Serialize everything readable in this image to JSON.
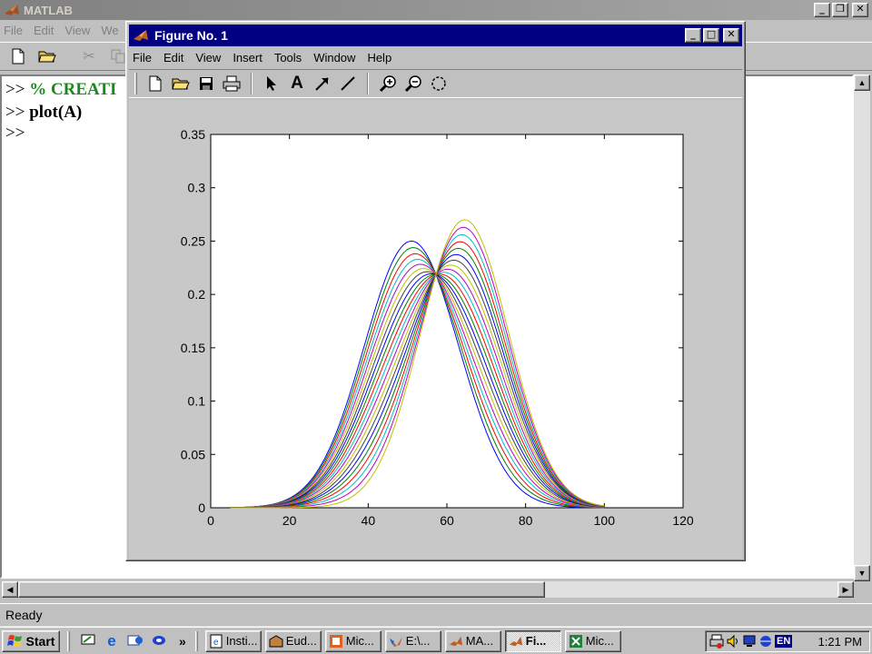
{
  "matlab": {
    "title": "MATLAB",
    "menu": [
      "File",
      "Edit",
      "View",
      "We"
    ],
    "command_lines": [
      {
        "prompt": ">>",
        "text": "% CREATI",
        "color": "#1a8a1a"
      },
      {
        "prompt": ">>",
        "text": "plot(A)",
        "color": "#000000"
      },
      {
        "prompt": ">>",
        "text": "",
        "color": "#000000"
      }
    ],
    "status": "Ready"
  },
  "figure": {
    "title": "Figure No. 1",
    "menu": [
      "File",
      "Edit",
      "View",
      "Insert",
      "Tools",
      "Window",
      "Help"
    ],
    "toolbar_icons": [
      "new-file-icon",
      "open-folder-icon",
      "save-icon",
      "print-icon",
      "arrow-select-icon",
      "text-insert-icon",
      "arrow-insert-icon",
      "line-insert-icon",
      "zoom-in-icon",
      "zoom-out-icon",
      "rotate-3d-icon"
    ]
  },
  "chart_data": {
    "type": "line",
    "title": "",
    "xlabel": "",
    "ylabel": "",
    "xlim": [
      0,
      120
    ],
    "ylim": [
      0,
      0.35
    ],
    "xticks": [
      0,
      20,
      40,
      60,
      80,
      100,
      120
    ],
    "yticks": [
      0,
      0.05,
      0.1,
      0.15,
      0.2,
      0.25,
      0.3,
      0.35
    ],
    "ytick_labels": [
      "0",
      "0.05",
      "0.1",
      "0.15",
      "0.2",
      "0.25",
      "0.3",
      "0.35"
    ],
    "grid": false,
    "legend": "none",
    "x_range": [
      5,
      100
    ],
    "crossing_point": {
      "x": 57,
      "y": 0.225
    },
    "series_count": 20,
    "curve_description": "Family of mixture curves of two Gaussian components (peak 51, sd 12 and peak 65, sd 11), weight shifting gradually from the first to the second",
    "components": [
      {
        "mean": 51,
        "sd": 12,
        "peak": 0.25
      },
      {
        "mean": 64.5,
        "sd": 11.2,
        "peak": 0.27
      }
    ],
    "colors": [
      "#0000ff",
      "#008000",
      "#ff0000",
      "#00bfbf",
      "#bf00bf",
      "#bfbf00",
      "#404040"
    ]
  },
  "taskbar": {
    "start_label": "Start",
    "quick_launch": [
      "desktop-icon",
      "internet-explorer-icon",
      "outlook-icon",
      "channels-icon"
    ],
    "more": "»",
    "tasks": [
      {
        "label": "Insti...",
        "icon": "ie-page-icon",
        "active": false
      },
      {
        "label": "Eud...",
        "icon": "eudora-icon",
        "active": false
      },
      {
        "label": "Mic...",
        "icon": "powerpoint-icon",
        "active": false
      },
      {
        "label": "E:\\...",
        "icon": "folder-icon",
        "active": false
      },
      {
        "label": "MA...",
        "icon": "matlab-icon",
        "active": false
      },
      {
        "label": "Fi...",
        "icon": "matlab-figure-icon",
        "active": true
      },
      {
        "label": "Mic...",
        "icon": "excel-icon",
        "active": false
      }
    ],
    "tray_icons": [
      "printer-icon",
      "volume-icon",
      "monitor-icon",
      "network-icon"
    ],
    "language": "EN",
    "clock": "1:21 PM"
  }
}
